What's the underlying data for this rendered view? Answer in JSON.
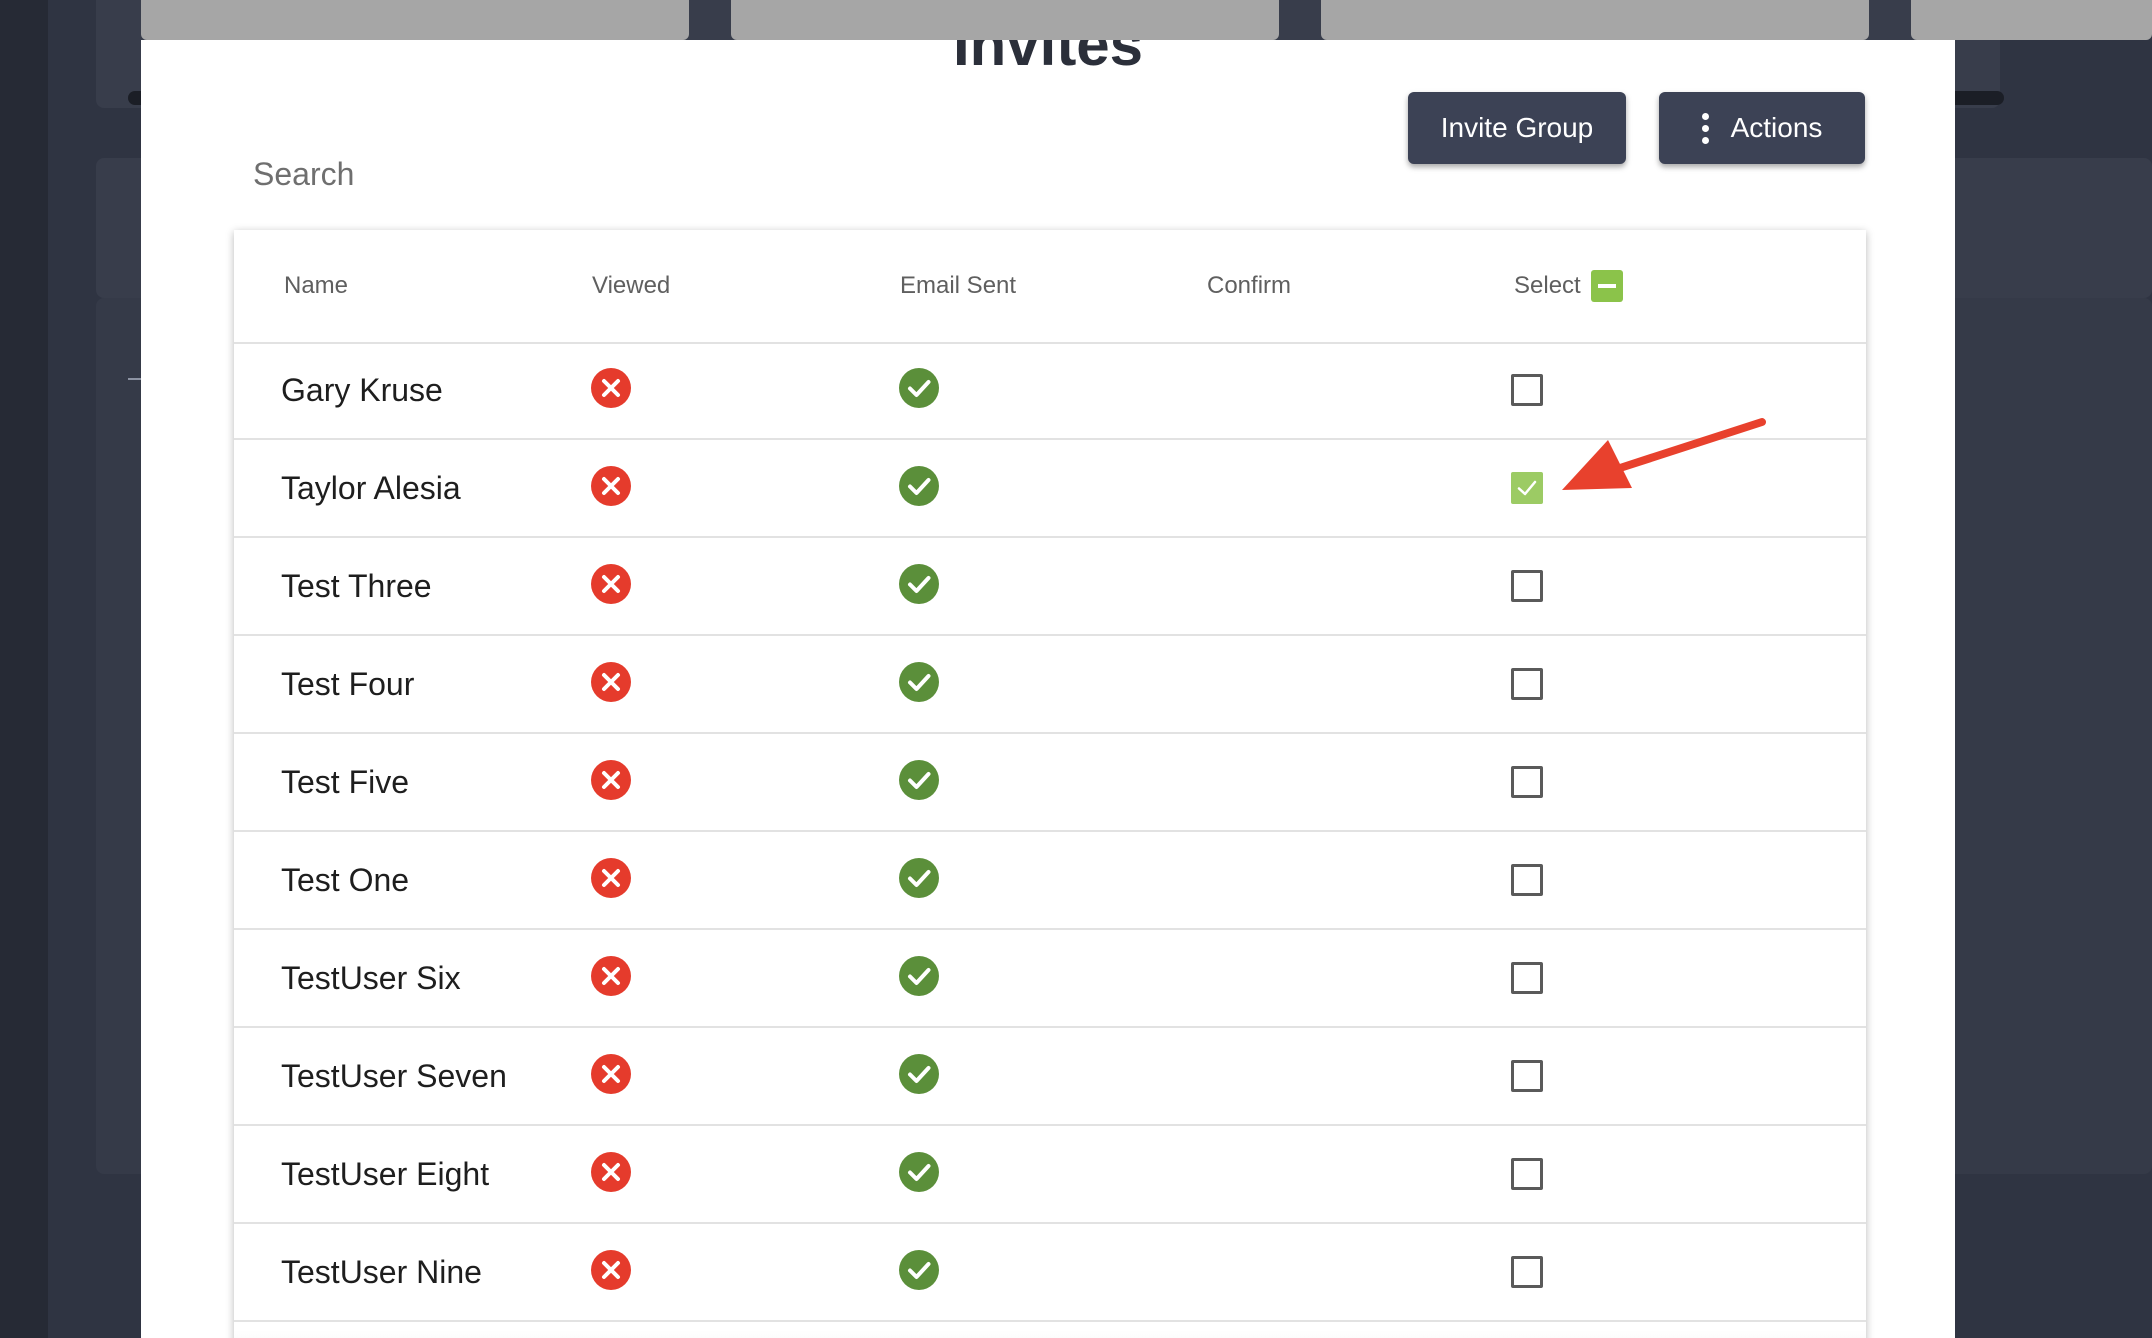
{
  "modal": {
    "title": "Invites",
    "search": {
      "placeholder": "Search",
      "value": ""
    },
    "buttons": {
      "invite_group": "Invite Group",
      "actions": "Actions"
    }
  },
  "table": {
    "columns": {
      "name": "Name",
      "viewed": "Viewed",
      "email_sent": "Email Sent",
      "confirm": "Confirm",
      "select": "Select"
    },
    "rows": [
      {
        "name": "Gary Kruse",
        "viewed": false,
        "email_sent": true,
        "selected": false
      },
      {
        "name": "Taylor Alesia",
        "viewed": false,
        "email_sent": true,
        "selected": true
      },
      {
        "name": "Test Three",
        "viewed": false,
        "email_sent": true,
        "selected": false
      },
      {
        "name": "Test Four",
        "viewed": false,
        "email_sent": true,
        "selected": false
      },
      {
        "name": "Test Five",
        "viewed": false,
        "email_sent": true,
        "selected": false
      },
      {
        "name": "Test One",
        "viewed": false,
        "email_sent": true,
        "selected": false
      },
      {
        "name": "TestUser Six",
        "viewed": false,
        "email_sent": true,
        "selected": false
      },
      {
        "name": "TestUser Seven",
        "viewed": false,
        "email_sent": true,
        "selected": false
      },
      {
        "name": "TestUser Eight",
        "viewed": false,
        "email_sent": true,
        "selected": false
      },
      {
        "name": "TestUser Nine",
        "viewed": false,
        "email_sent": true,
        "selected": false
      }
    ]
  },
  "icons": {
    "not_viewed": "x-circle-icon",
    "email_sent": "check-circle-icon",
    "select_all": "indeterminate-checkbox-icon",
    "actions": "kebab-menu-icon",
    "annotation": "red-arrow-icon"
  },
  "colors": {
    "button_bg": "#3c4255",
    "error_red": "#e53b2c",
    "success_green": "#5b8f3a",
    "checkbox_green": "#8bc34a",
    "annotation_red": "#e8412d",
    "backdrop": "#2f3442"
  }
}
